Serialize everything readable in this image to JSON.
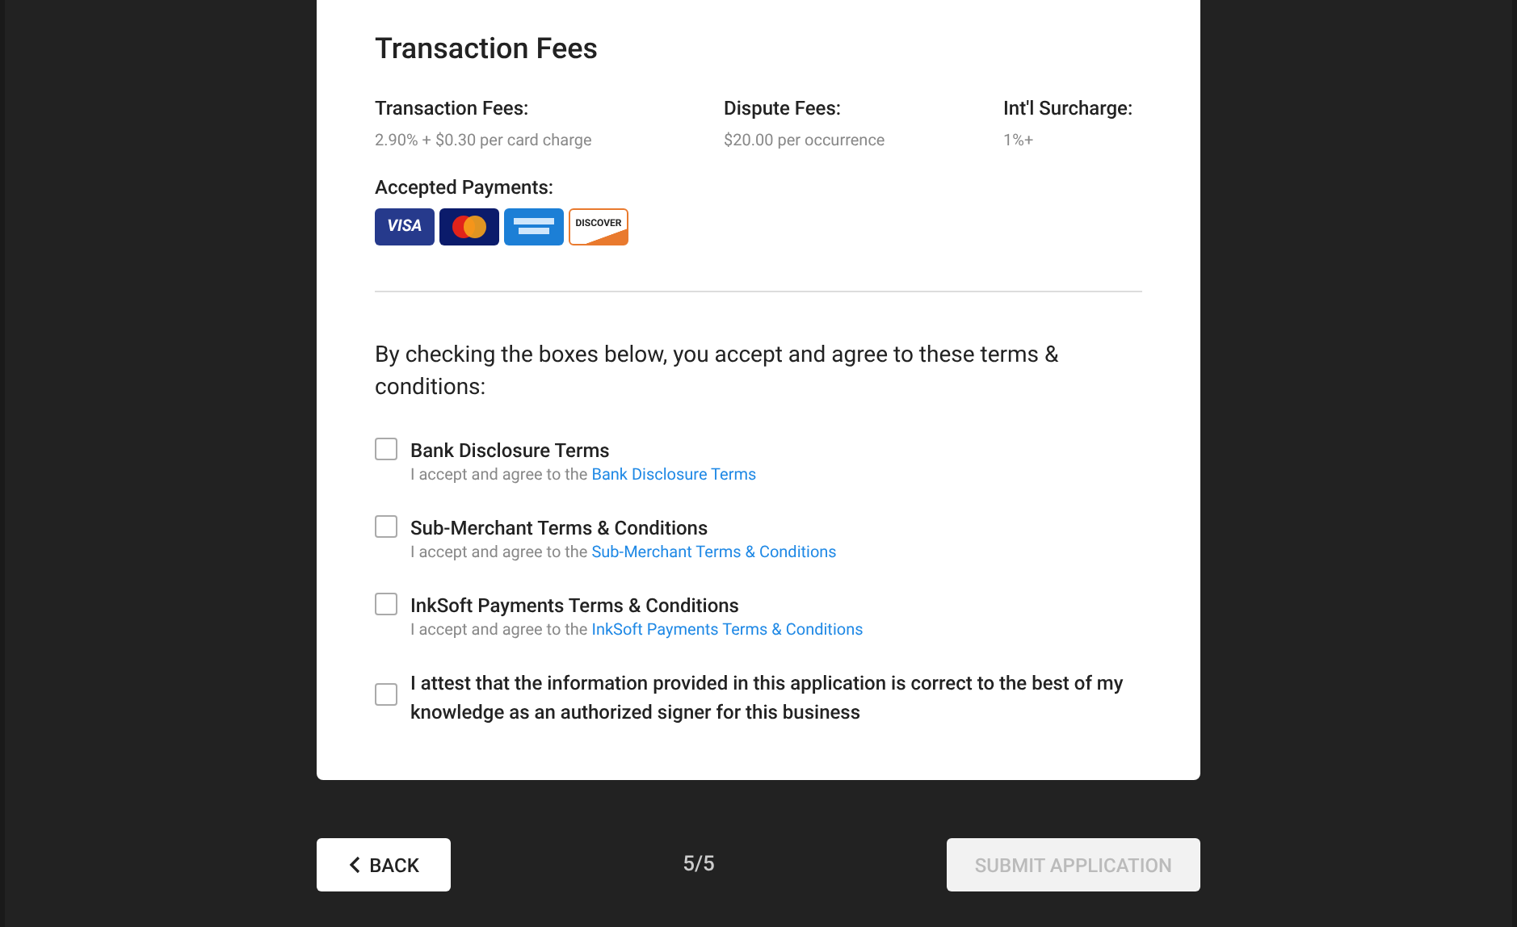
{
  "section_title": "Transaction Fees",
  "fees": [
    {
      "label": "Transaction Fees:",
      "value": "2.90% + $0.30 per card charge"
    },
    {
      "label": "Dispute Fees:",
      "value": "$20.00 per occurrence"
    },
    {
      "label": "Int'l Surcharge:",
      "value": "1%+"
    }
  ],
  "payments": {
    "label": "Accepted Payments:",
    "cards": [
      {
        "kind": "visa",
        "label": "VISA"
      },
      {
        "kind": "mastercard"
      },
      {
        "kind": "amex"
      },
      {
        "kind": "discover",
        "label": "DISCOVER"
      }
    ]
  },
  "terms_intro": "By checking the boxes below, you accept and agree to these terms & conditions:",
  "terms": [
    {
      "title": "Bank Disclosure Terms",
      "prefix": "I accept and agree to the",
      "link": "Bank Disclosure Terms",
      "checked": false
    },
    {
      "title": "Sub-Merchant Terms & Conditions",
      "prefix": "I accept and agree to the",
      "link": "Sub-Merchant Terms & Conditions",
      "checked": false
    },
    {
      "title": "InkSoft Payments Terms & Conditions",
      "prefix": "I accept and agree to the",
      "link": "InkSoft Payments Terms & Conditions",
      "checked": false
    },
    {
      "title": "I attest that the information provided in this application is correct to the best of my knowledge as an authorized signer for this business",
      "checked": false
    }
  ],
  "footer": {
    "back": "BACK",
    "step": "5/5",
    "submit": {
      "label": "SUBMIT APPLICATION",
      "disabled": true
    }
  }
}
